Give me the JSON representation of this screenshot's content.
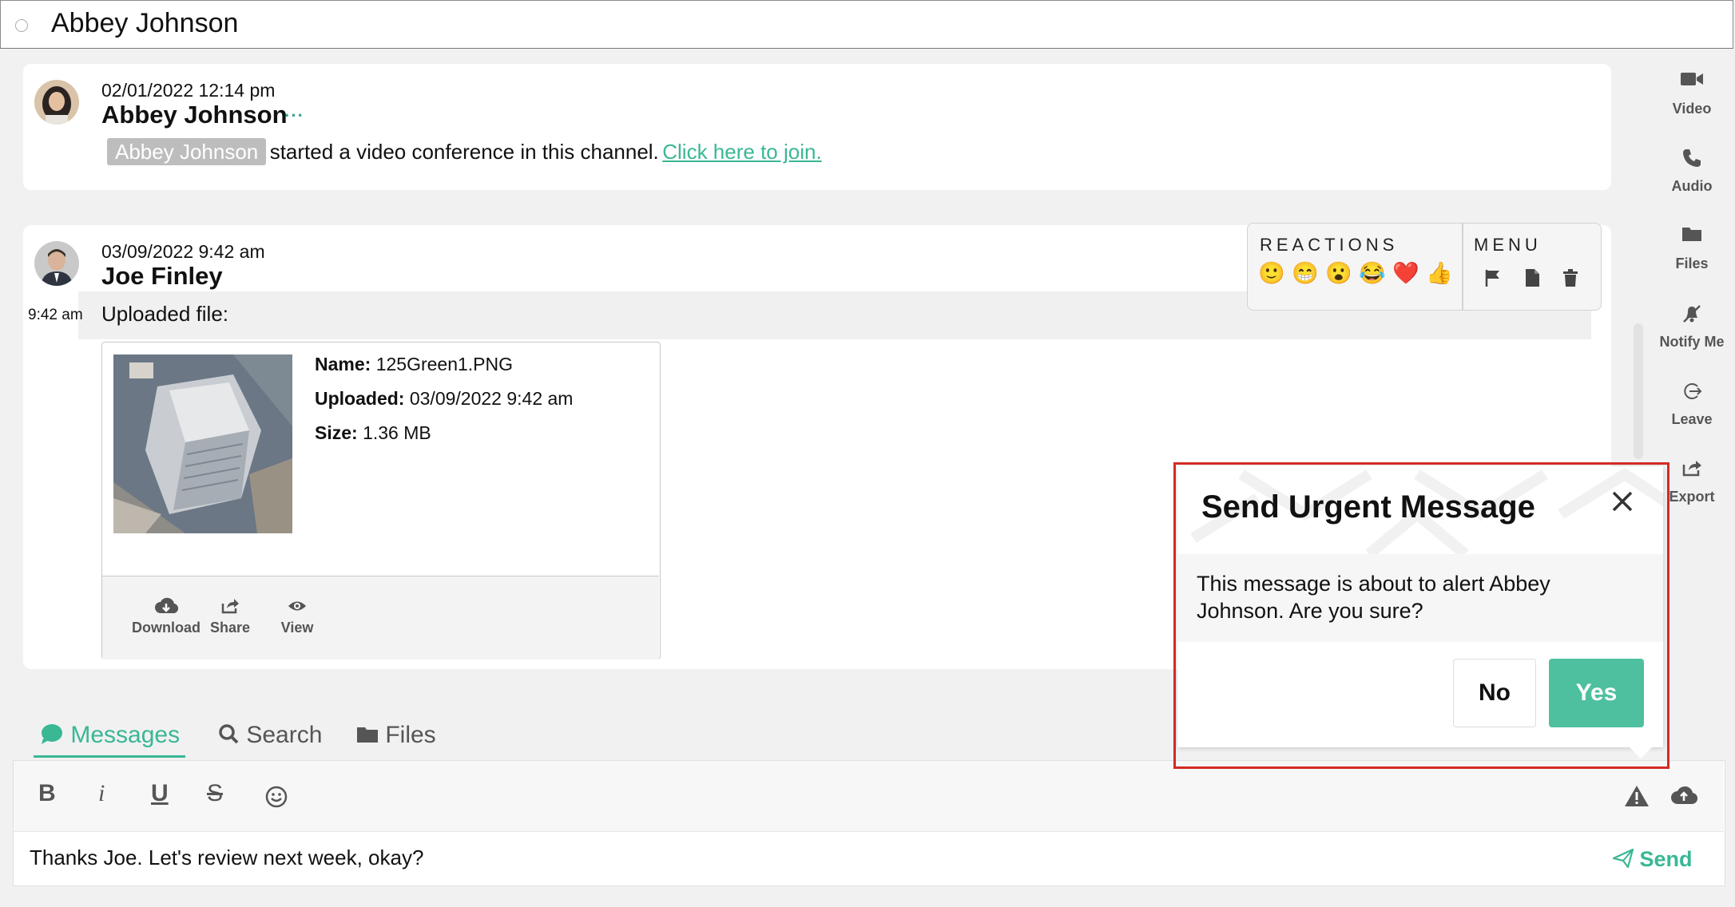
{
  "header": {
    "title": "Abbey Johnson"
  },
  "messages": [
    {
      "date": "02/01/2022 12:14 pm",
      "author": "Abbey Johnson",
      "more": "···",
      "mention": "Abbey Johnson",
      "text": "started a video conference in this channel.",
      "link": "Click here to join."
    },
    {
      "date": "03/09/2022 9:42 am",
      "author": "Joe Finley",
      "side_time": "9:42 am",
      "text": "Uploaded file:",
      "file": {
        "name_label": "Name:",
        "name": "125Green1.PNG",
        "uploaded_label": "Uploaded:",
        "uploaded": "03/09/2022 9:42 am",
        "size_label": "Size:",
        "size": "1.36 MB",
        "actions": [
          "Download",
          "Share",
          "View"
        ]
      }
    }
  ],
  "reactions_popover": {
    "reactions_title": "REACTIONS",
    "menu_title": "MENU",
    "emojis": [
      "🙂",
      "😁",
      "😮",
      "😂",
      "❤️",
      "👍"
    ],
    "menu_icons": [
      "flag-icon",
      "document-icon",
      "trash-icon"
    ]
  },
  "right_rail": [
    "Video",
    "Audio",
    "Files",
    "Notify Me",
    "Leave",
    "Export"
  ],
  "tabs": [
    "Messages",
    "Search",
    "Files"
  ],
  "toolbar": {
    "bold": "B",
    "italic": "i",
    "underline": "U",
    "strike": "S"
  },
  "composer": {
    "text": "Thanks Joe.  Let's review next week, okay?",
    "send_label": "Send"
  },
  "dialog": {
    "title": "Send Urgent Message",
    "body": "This message is about to alert Abbey Johnson. Are you sure?",
    "no_label": "No",
    "yes_label": "Yes"
  },
  "colors": {
    "accent": "#3ab795",
    "yes_button": "#4fc09f",
    "highlight_border": "#d32a24"
  }
}
